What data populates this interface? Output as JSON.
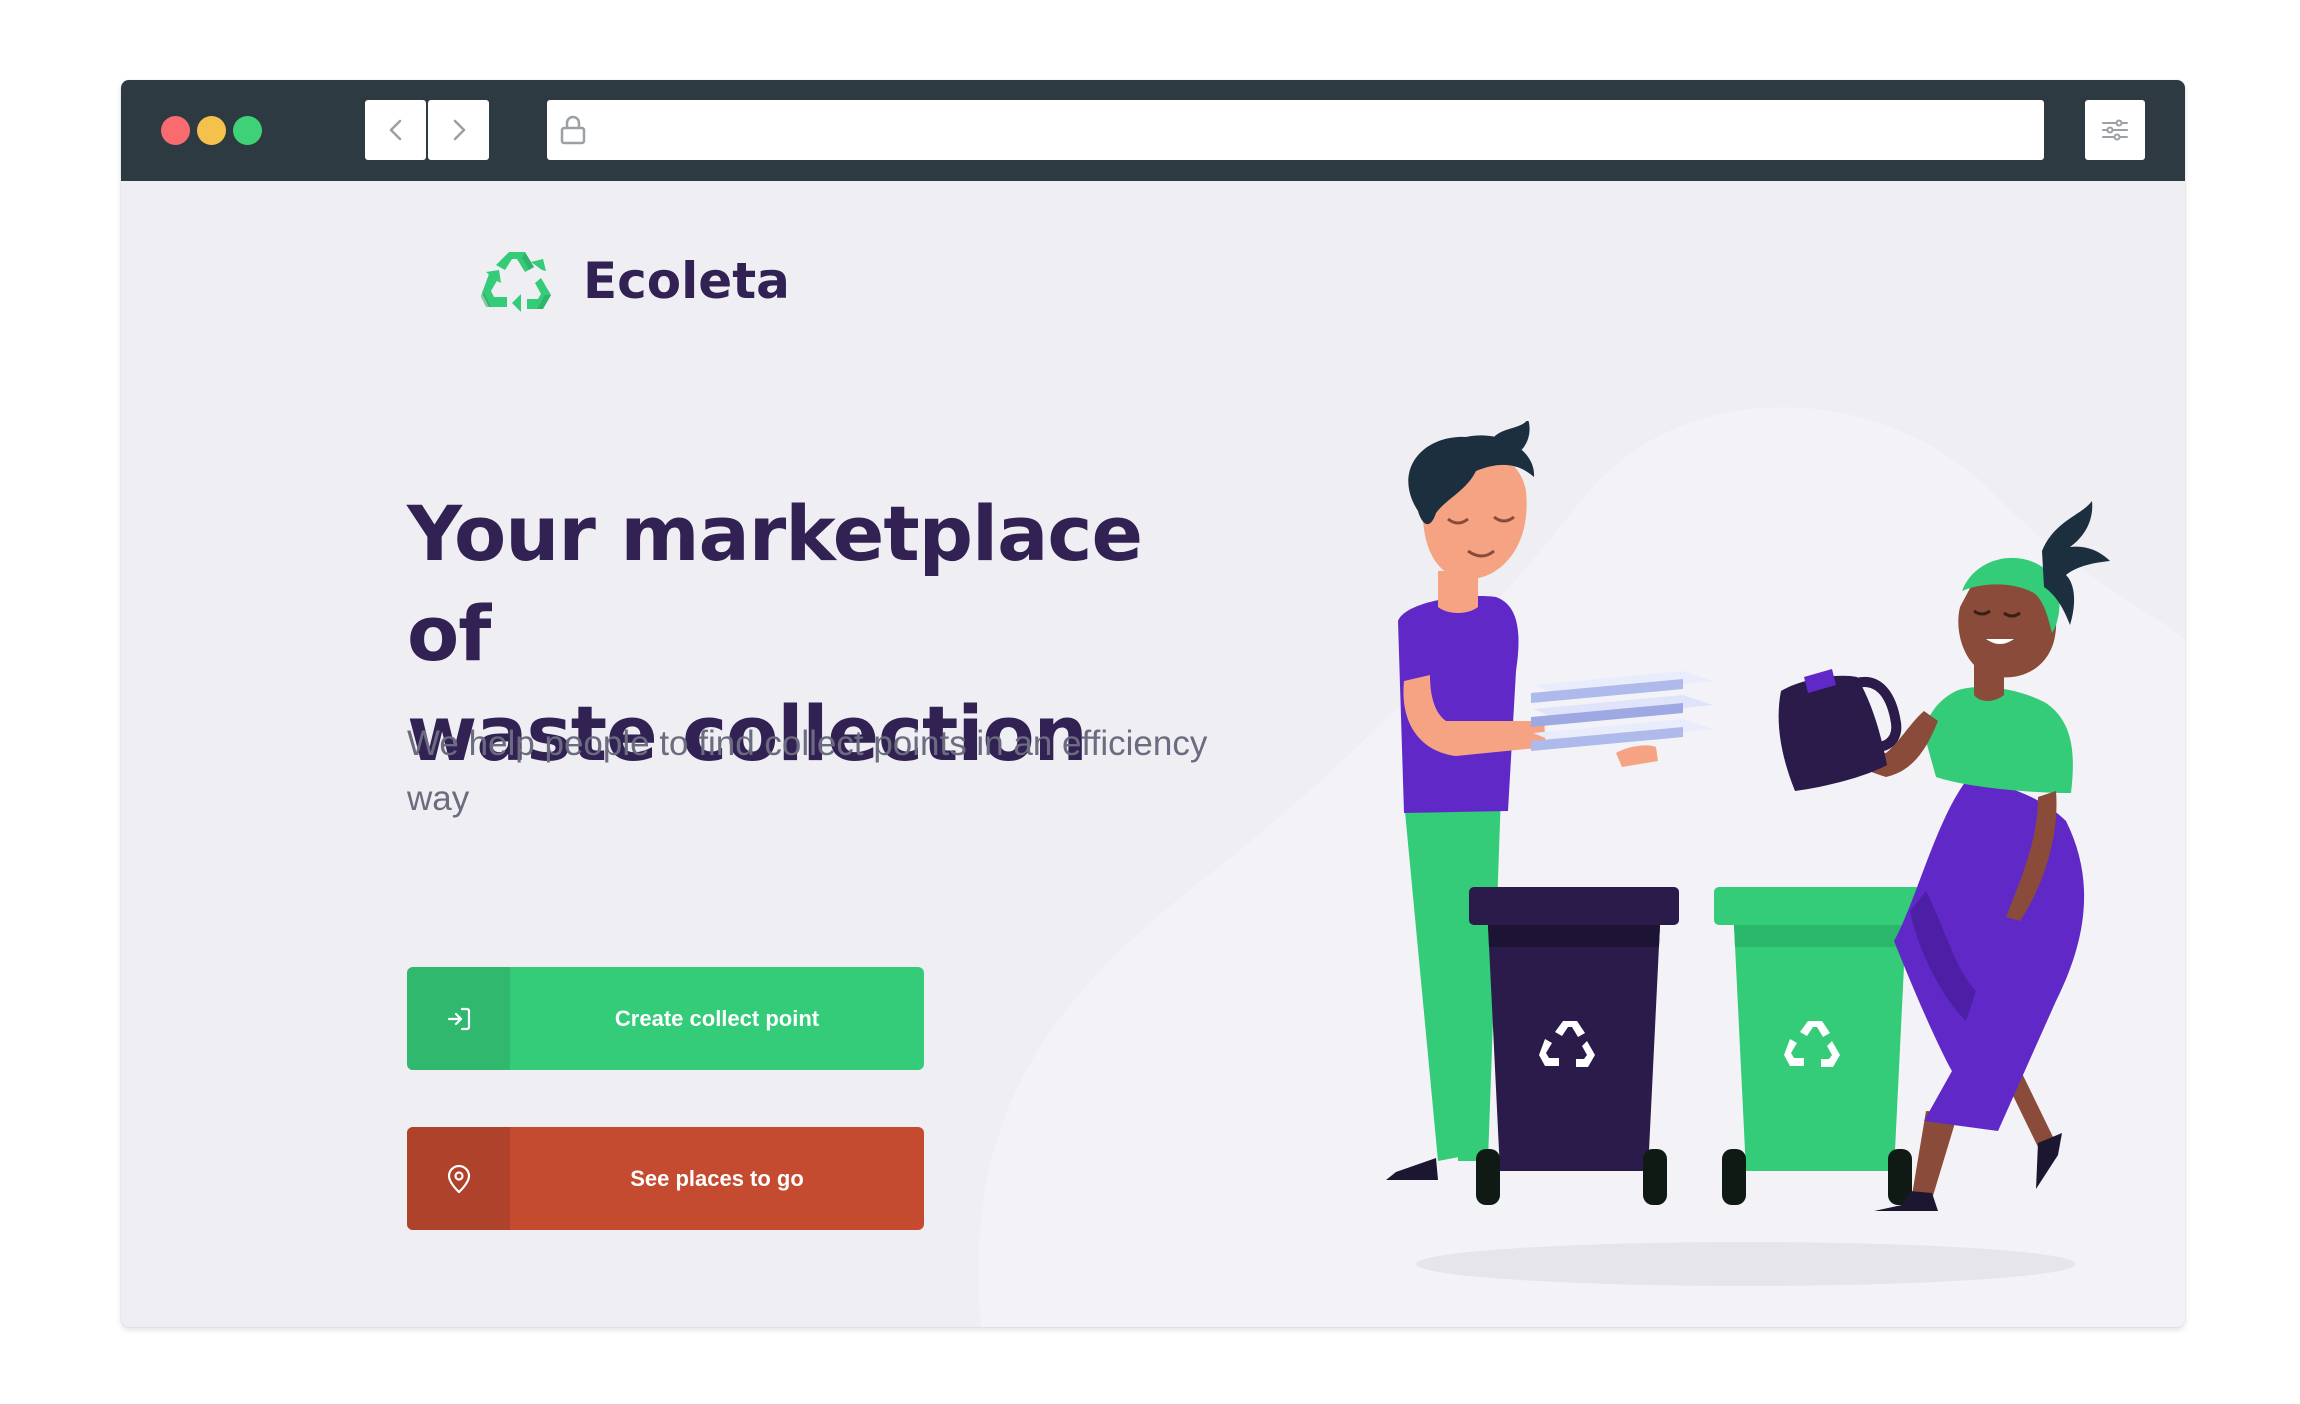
{
  "browser": {
    "url": "",
    "back_icon": "chevron-left-icon",
    "forward_icon": "chevron-right-icon",
    "lock_icon": "lock-icon",
    "settings_icon": "sliders-icon",
    "colors": {
      "titlebar": "#2e3a41",
      "close": "#f96b6f",
      "minimize": "#f4c14d",
      "maximize": "#3fd178"
    }
  },
  "header": {
    "logo_icon": "recycle-icon",
    "logo_text": "Ecoleta"
  },
  "hero": {
    "title_line1": "Your marketplace of",
    "title_line2": "waste collection",
    "subtitle": "We help people to find collect points in an efficiency way"
  },
  "actions": {
    "create": {
      "label": "Create collect point",
      "icon": "log-in-icon",
      "color": "#34cb79"
    },
    "places": {
      "label": "See places to go",
      "icon": "map-pin-icon",
      "color": "#c54b30"
    }
  },
  "colors": {
    "primary": "#322153",
    "accent": "#34cb79",
    "text": "#6c6c80",
    "background": "#efeef3"
  }
}
